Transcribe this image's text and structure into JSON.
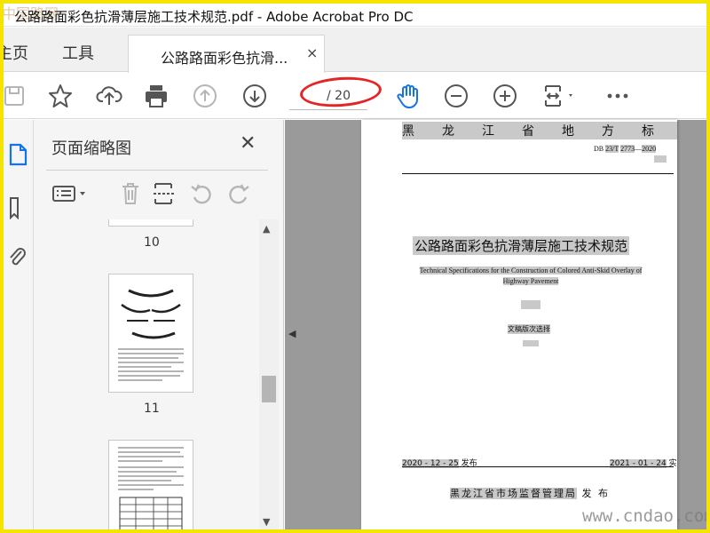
{
  "window": {
    "title": "公路路面彩色抗滑薄层施工技术规范.pdf - Adobe Acrobat Pro DC",
    "watermark_top": "中国路网"
  },
  "tabs": {
    "home": "主页",
    "tools": "工具",
    "document": "公路路面彩色抗滑...",
    "close": "×"
  },
  "toolbar": {
    "page_total": "/ 20",
    "icons": [
      "save-icon",
      "star-icon",
      "upload-icon",
      "print-icon",
      "page-up-icon",
      "page-down-icon",
      "hand-icon",
      "zoom-out-icon",
      "zoom-in-icon",
      "fit-page-icon",
      "more-icon"
    ]
  },
  "panel": {
    "title": "页面缩略图",
    "close": "✕",
    "thumbnails": [
      {
        "label": "10"
      },
      {
        "label": "11"
      }
    ]
  },
  "document": {
    "standard_title": "黑龙江省地方标准",
    "code_prefix": "DB",
    "code": "23/T",
    "number": "2773",
    "year": "2020",
    "title_cn": "公路路面彩色抗滑薄层施工技术规范",
    "title_en": "Technical Specifications for the Construction of Colored Anti-Skid Overlay of Highway Pavement",
    "draft_label": "文稿版次选择",
    "publish_date": "2020 - 12 - 25",
    "publish_label": "发布",
    "effective_date": "2021 - 01 - 24",
    "effective_label": "实施",
    "issuer": "黑龙江省市场监督管理局",
    "issue_label": "发 布"
  },
  "watermark": "www.cndao.com",
  "colors": {
    "frame": "#f5e400",
    "highlight_oval": "#e52525",
    "hand_tool": "#1473e6"
  }
}
